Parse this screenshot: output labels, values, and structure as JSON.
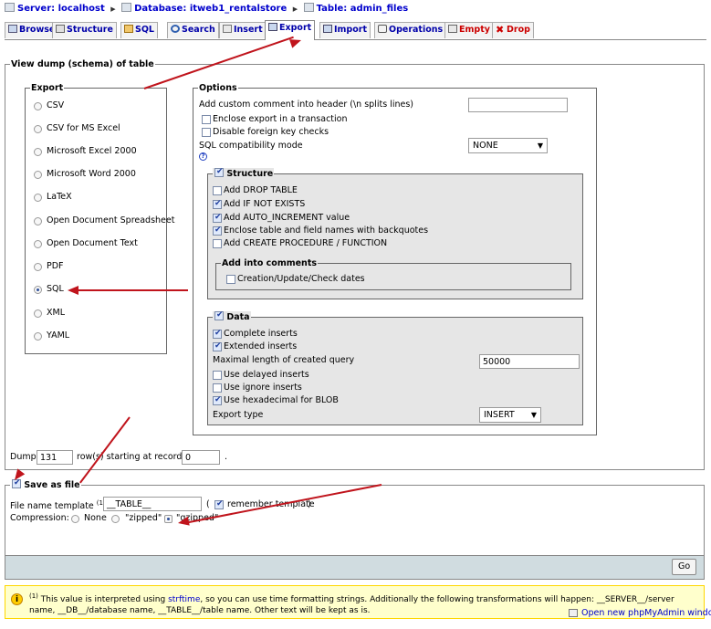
{
  "breadcrumb": {
    "server": "Server: localhost",
    "database": "Database: itweb1_rentalstore",
    "table": "Table: admin_files"
  },
  "tabs": [
    {
      "label": "Browse"
    },
    {
      "label": "Structure"
    },
    {
      "label": "SQL"
    },
    {
      "label": "Search"
    },
    {
      "label": "Insert"
    },
    {
      "label": "Export",
      "active": true
    },
    {
      "label": "Import"
    },
    {
      "label": "Operations"
    },
    {
      "label": "Empty"
    },
    {
      "label": "Drop"
    }
  ],
  "view_dump": {
    "legend": "View dump (schema) of table",
    "export": {
      "legend": "Export",
      "formats": [
        "CSV",
        "CSV for MS Excel",
        "Microsoft Excel 2000",
        "Microsoft Word 2000",
        "LaTeX",
        "Open Document Spreadsheet",
        "Open Document Text",
        "PDF",
        "SQL",
        "XML",
        "YAML"
      ],
      "selected": "SQL"
    },
    "options": {
      "legend": "Options",
      "comment_label": "Add custom comment into header (\\n splits lines)",
      "comment_value": "",
      "enclose_transaction": "Enclose export in a transaction",
      "disable_fk": "Disable foreign key checks",
      "compat_label": "SQL compatibility mode",
      "compat_value": "NONE",
      "structure": {
        "legend": "Structure",
        "drop_table": "Add DROP TABLE",
        "if_not_exists": "Add IF NOT EXISTS",
        "auto_increment": "Add AUTO_INCREMENT value",
        "backquotes": "Enclose table and field names with backquotes",
        "procedure": "Add CREATE PROCEDURE / FUNCTION",
        "comments_legend": "Add into comments",
        "dates": "Creation/Update/Check dates"
      },
      "data": {
        "legend": "Data",
        "complete_inserts": "Complete inserts",
        "extended_inserts": "Extended inserts",
        "max_length_label": "Maximal length of created query",
        "max_length_value": "50000",
        "delayed_inserts": "Use delayed inserts",
        "ignore_inserts": "Use ignore inserts",
        "hex_blob": "Use hexadecimal for BLOB",
        "export_type_label": "Export type",
        "export_type_value": "INSERT"
      }
    },
    "dump_label": "Dump",
    "dump_rows": "131",
    "rows_starting": "row(s) starting at record #",
    "start_record": "0",
    "trailing_dot": "."
  },
  "save_as_file": {
    "legend": "Save as file",
    "template_label": "File name template",
    "template_sup": "(1)",
    "template_colon": ":",
    "template_value": "__TABLE__",
    "paren_open": "(",
    "remember_label": "remember template",
    "paren_close": ")",
    "compression_label": "Compression:",
    "none": "None",
    "zipped": "\"zipped\"",
    "gzipped": "\"gzipped\""
  },
  "go_button": "Go",
  "footnote": {
    "sup": "(1)",
    "before": "This value is interpreted using",
    "link": "strftime",
    "after": ", so you can use time formatting strings. Additionally the following transformations will happen: __SERVER__/server name, __DB__/database name, __TABLE__/table name. Other text will be kept as is."
  },
  "open_window": "Open new phpMyAdmin window",
  "colors": {
    "link": "#0000cc",
    "arrow": "#c0141c",
    "note_bg": "#ffffcc",
    "panel_gray": "#e6e6e6"
  }
}
